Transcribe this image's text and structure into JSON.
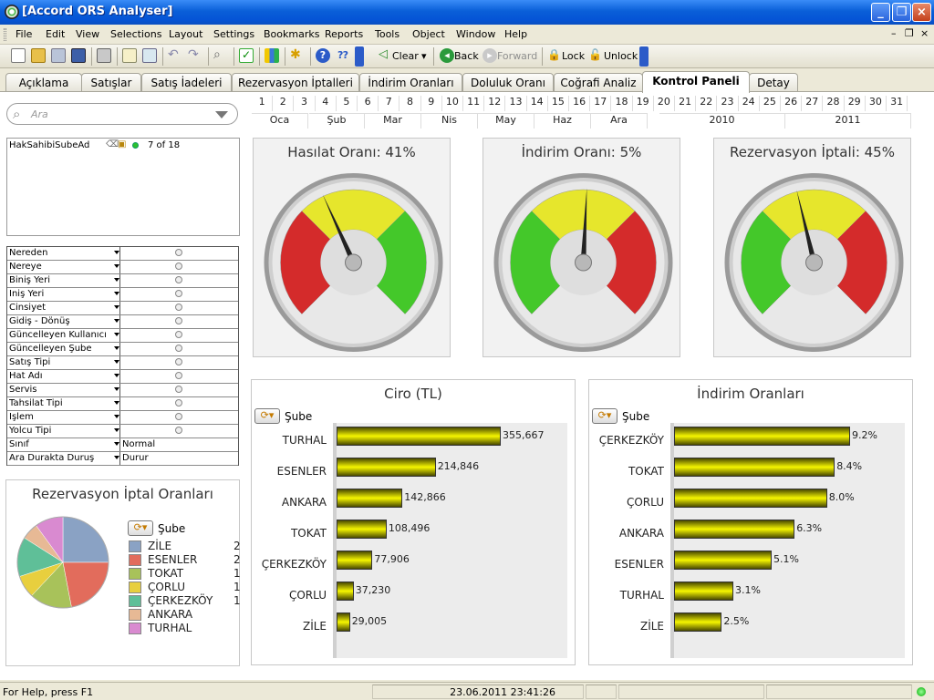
{
  "window": {
    "title": "[Accord ORS Analyser]"
  },
  "menu": [
    "File",
    "Edit",
    "View",
    "Selections",
    "Layout",
    "Settings",
    "Bookmarks",
    "Reports",
    "Tools",
    "Object",
    "Window",
    "Help"
  ],
  "toolbar": {
    "clear": "Clear",
    "back": "Back",
    "forward": "Forward",
    "lock": "Lock",
    "unlock": "Unlock"
  },
  "tabs": [
    "Açıklama",
    "Satışlar",
    "Satış İadeleri",
    "Rezervasyon İptalleri",
    "İndirim Oranları",
    "Doluluk Oranı",
    "Coğrafi Analiz",
    "Kontrol Paneli",
    "Detay"
  ],
  "active_tab": "Kontrol Paneli",
  "search": {
    "placeholder": "Ara"
  },
  "calendar": {
    "days": [
      "1",
      "2",
      "3",
      "4",
      "5",
      "6",
      "7",
      "8",
      "9",
      "10",
      "11",
      "12",
      "13",
      "14",
      "15",
      "16",
      "17",
      "18",
      "19",
      "20",
      "21",
      "22",
      "23",
      "24",
      "25",
      "26",
      "27",
      "28",
      "29",
      "30",
      "31"
    ],
    "months": [
      "Oca",
      "Şub",
      "Mar",
      "Nis",
      "May",
      "Haz",
      "Ara"
    ],
    "years": [
      "2010",
      "2011"
    ]
  },
  "branch_box": {
    "field": "HakSahibiSubeAd",
    "count": "7 of 18"
  },
  "filters": [
    {
      "label": "Nereden",
      "value": ""
    },
    {
      "label": "Nereye",
      "value": ""
    },
    {
      "label": "Biniş Yeri",
      "value": ""
    },
    {
      "label": "İniş Yeri",
      "value": ""
    },
    {
      "label": "Cinsiyet",
      "value": ""
    },
    {
      "label": "Gidiş - Dönüş",
      "value": ""
    },
    {
      "label": "Güncelleyen Kullanıcı",
      "value": ""
    },
    {
      "label": "Güncelleyen Şube",
      "value": ""
    },
    {
      "label": "Satış Tipi",
      "value": ""
    },
    {
      "label": "Hat Adı",
      "value": ""
    },
    {
      "label": "Servis",
      "value": ""
    },
    {
      "label": "Tahsilat Tipi",
      "value": ""
    },
    {
      "label": "İşlem",
      "value": ""
    },
    {
      "label": "Yolcu Tipi",
      "value": ""
    },
    {
      "label": "Sınıf",
      "value": "Normal"
    },
    {
      "label": "Ara Durakta Duruş",
      "value": "Durur"
    }
  ],
  "gauges": [
    {
      "title": "Hasılat Oranı: 41%",
      "value": 0.41,
      "segments": [
        "red",
        "yellow",
        "green"
      ]
    },
    {
      "title": "İndirim Oranı: 5%",
      "value": 0.51,
      "segments": [
        "green",
        "yellow",
        "red"
      ]
    },
    {
      "title": "Rezervasyon İptali: 45%",
      "value": 0.45,
      "segments": [
        "green",
        "yellow",
        "red"
      ]
    }
  ],
  "pie_panel": {
    "title": "Rezervasyon İptal Oranları",
    "legend_title": "Şube",
    "legend": [
      {
        "name": "ZİLE",
        "color": "#8aa2c4",
        "extra": "2"
      },
      {
        "name": "ESENLER",
        "color": "#e26c5c",
        "extra": "2"
      },
      {
        "name": "TOKAT",
        "color": "#a8c25a",
        "extra": "1"
      },
      {
        "name": "ÇORLU",
        "color": "#e8cf3e",
        "extra": "1"
      },
      {
        "name": "ÇERKEZKÖY",
        "color": "#5fbf98",
        "extra": "1"
      },
      {
        "name": "ANKARA",
        "color": "#e7b995",
        "extra": ""
      },
      {
        "name": "TURHAL",
        "color": "#d98ad0",
        "extra": ""
      }
    ]
  },
  "chart_data": [
    {
      "type": "bar",
      "title": "Ciro (TL)",
      "legend_title": "Şube",
      "categories": [
        "TURHAL",
        "ESENLER",
        "ANKARA",
        "TOKAT",
        "ÇERKEZKÖY",
        "ÇORLU",
        "ZİLE"
      ],
      "values": [
        355667,
        214846,
        142866,
        108496,
        77906,
        37230,
        29005
      ],
      "labels": [
        "355,667",
        "214,846",
        "142,866",
        "108,496",
        "77,906",
        "37,230",
        "29,005"
      ]
    },
    {
      "type": "bar",
      "title": "İndirim Oranları",
      "legend_title": "Şube",
      "categories": [
        "ÇERKEZKÖY",
        "TOKAT",
        "ÇORLU",
        "ANKARA",
        "ESENLER",
        "TURHAL",
        "ZİLE"
      ],
      "values": [
        9.2,
        8.4,
        8.0,
        6.3,
        5.1,
        3.1,
        2.5
      ],
      "labels": [
        "9.2%",
        "8.4%",
        "8.0%",
        "6.3%",
        "5.1%",
        "3.1%",
        "2.5%"
      ]
    },
    {
      "type": "pie",
      "title": "Rezervasyon İptal Oranları",
      "categories": [
        "ZİLE",
        "ESENLER",
        "TOKAT",
        "ÇORLU",
        "ÇERKEZKÖY",
        "ANKARA",
        "TURHAL"
      ],
      "values": [
        25,
        22,
        15,
        8,
        14,
        6,
        10
      ]
    }
  ],
  "status": {
    "help": "For Help, press F1",
    "datetime": "23.06.2011 23:41:26"
  }
}
